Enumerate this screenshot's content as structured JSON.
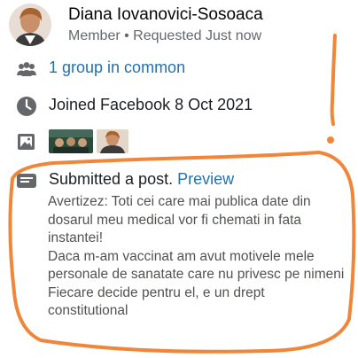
{
  "profile": {
    "name": "Diana Iovanovici-Sosoaca",
    "subtitle": "Member • Requested Just now"
  },
  "details": {
    "groups_text": "1 group in common",
    "joined_text": "Joined Facebook 8 Oct 2021"
  },
  "post": {
    "action_text": "Submitted a post.",
    "preview_link": "Preview",
    "lines": [
      "Avertizez: Toti cei care mai publica date din dosarul meu medical vor fi chemati in fata instantei!",
      "Daca m-am vaccinat am avut motivele mele personale de sanatate care nu privesc pe nimeni",
      "Fiecare decide pentru el, e un drept constitutional"
    ]
  },
  "icons": {
    "group": "group-icon",
    "clock": "clock-icon",
    "photo": "photo-icon",
    "post": "post-icon"
  },
  "colors": {
    "link": "#2271b1",
    "icon": "#65676b",
    "annotation": "#f0863a"
  }
}
